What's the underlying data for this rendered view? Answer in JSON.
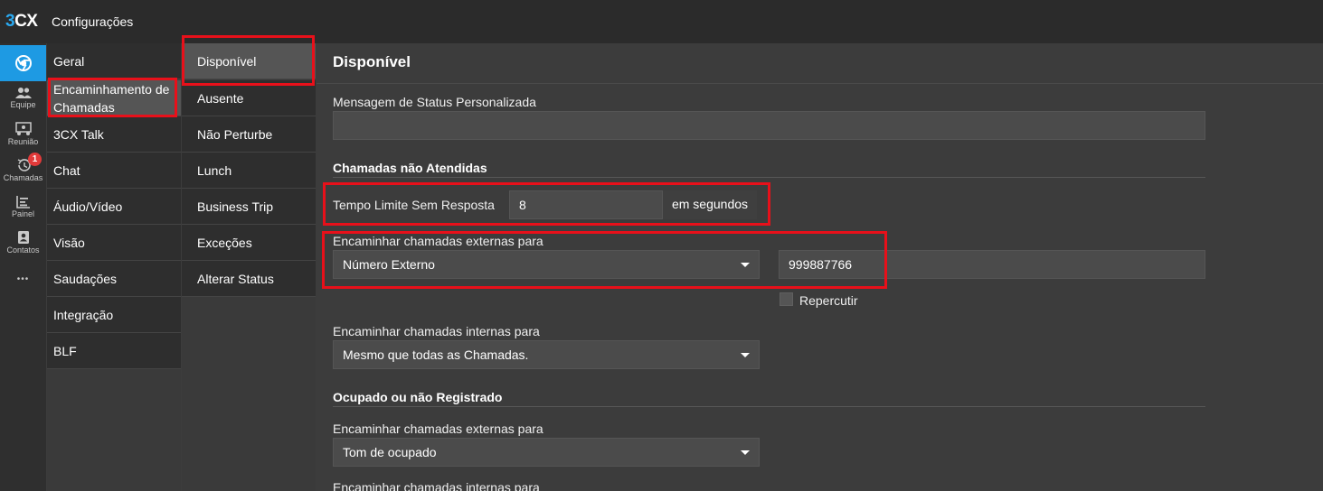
{
  "app": {
    "logo_number": "3",
    "logo_letters": "CX",
    "title": "Configurações"
  },
  "rail": [
    {
      "icon": "chrome-icon",
      "label": ""
    },
    {
      "icon": "team-icon",
      "label": "Equipe"
    },
    {
      "icon": "meeting-icon",
      "label": "Reunião"
    },
    {
      "icon": "calls-history-icon",
      "label": "Chamadas",
      "badge": "1"
    },
    {
      "icon": "panel-icon",
      "label": "Painel"
    },
    {
      "icon": "contacts-icon",
      "label": "Contatos"
    },
    {
      "icon": "more-icon",
      "label": "•••"
    }
  ],
  "menu1": {
    "items": [
      "Geral",
      "Encaminhamento de Chamadas",
      "3CX Talk",
      "Chat",
      "Áudio/Vídeo",
      "Visão",
      "Saudações",
      "Integração",
      "BLF"
    ],
    "forwarding_line1": "Encaminhamento de",
    "forwarding_line2": "Chamadas"
  },
  "menu2": {
    "items": [
      "Disponível",
      "Ausente",
      "Não Perturbe",
      "Lunch",
      "Business Trip",
      "Exceções",
      "Alterar Status"
    ]
  },
  "content": {
    "title": "Disponível",
    "custom_status_label": "Mensagem de Status Personalizada",
    "custom_status_value": "",
    "missed_section": "Chamadas não Atendidas",
    "timeout_label": "Tempo Limite Sem Resposta",
    "timeout_value": "8",
    "timeout_unit": "em segundos",
    "external_label": "Encaminhar chamadas externas para",
    "external_select": "Número Externo",
    "external_number": "999887766",
    "bounce_label": "Repercutir",
    "internal_label": "Encaminhar chamadas internas para",
    "internal_select": "Mesmo que todas as Chamadas.",
    "busy_section": "Ocupado ou não Registrado",
    "busy_external_label": "Encaminhar chamadas externas para",
    "busy_external_select": "Tom de ocupado",
    "busy_internal_label": "Encaminhar chamadas internas para"
  },
  "colors": {
    "accent": "#1e9ae3",
    "highlight": "#e8101a",
    "badge": "#e23a3a"
  }
}
